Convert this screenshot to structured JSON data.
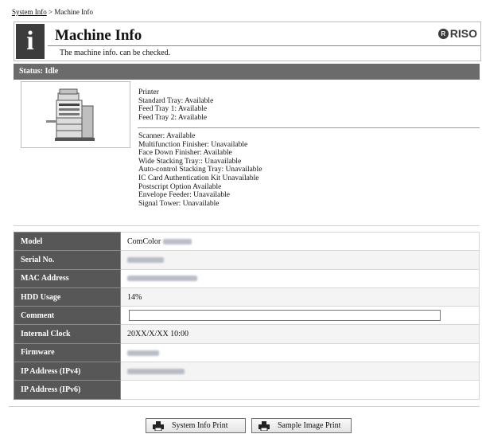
{
  "breadcrumb": {
    "link": "System Info",
    "separator": ">",
    "current": "Machine Info"
  },
  "header": {
    "title": "Machine Info",
    "description": "The machine info. can be checked.",
    "logo": "RISO",
    "info_icon": "info-icon"
  },
  "status": {
    "label": "Status: Idle"
  },
  "printer_status": [
    "Printer",
    "Standard Tray: Available",
    "Feed Tray 1: Available",
    "Feed Tray 2: Available"
  ],
  "options_status": [
    "Scanner: Available",
    "Multifunction Finisher: Unavailable",
    "Face Down Finisher: Available",
    "Wide Stacking Tray:: Unavailable",
    "Auto-control Stacking Tray: Unavailable",
    "IC Card Authentication Kit Unavailable",
    "Postscript Option Available",
    "Envelope Feeder: Unavailable",
    "Signal Tower: Unavailable"
  ],
  "specs": {
    "model": {
      "label": "Model",
      "value": "ComColor"
    },
    "serial": {
      "label": "Serial No."
    },
    "mac": {
      "label": "MAC Address"
    },
    "hdd": {
      "label": "HDD Usage",
      "value": "14%"
    },
    "comment": {
      "label": "Comment",
      "value": ""
    },
    "clock": {
      "label": "Internal Clock",
      "value": "20XX/X/XX 10:00"
    },
    "firmware": {
      "label": "Firmware"
    },
    "ipv4": {
      "label": "IP Address (IPv4)"
    },
    "ipv6": {
      "label": "IP Address (IPv6)",
      "value": ""
    }
  },
  "buttons": {
    "system_info_print": "System Info Print",
    "sample_image_print": "Sample Image Print"
  },
  "colors": {
    "status_bar": "#6b6b6b",
    "label_cell": "#575757",
    "icon_bg": "#3c3c3c"
  }
}
